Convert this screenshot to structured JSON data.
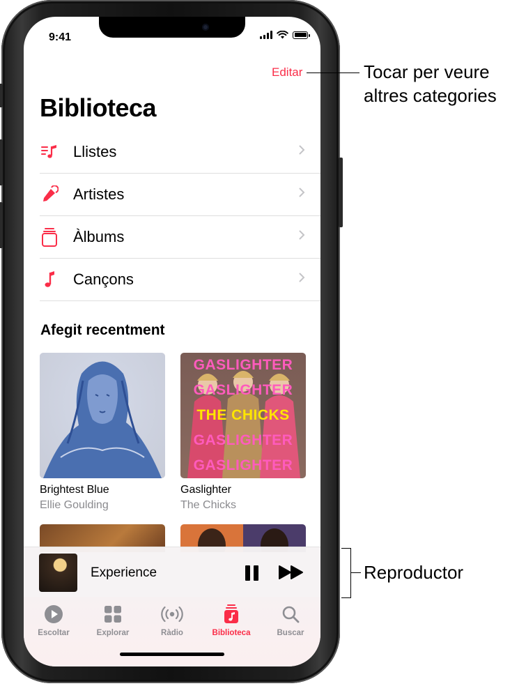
{
  "status_bar": {
    "time": "9:41"
  },
  "header": {
    "edit_label": "Editar",
    "title": "Biblioteca"
  },
  "library_menu": [
    {
      "label": "Llistes",
      "icon": "playlist-icon"
    },
    {
      "label": "Artistes",
      "icon": "microphone-icon"
    },
    {
      "label": "Àlbums",
      "icon": "album-stack-icon"
    },
    {
      "label": "Cançons",
      "icon": "music-note-icon"
    }
  ],
  "recently_added": {
    "title": "Afegit recentment",
    "albums": [
      {
        "title": "Brightest Blue",
        "artist": "Ellie Goulding"
      },
      {
        "title": "Gaslighter",
        "artist": "The Chicks"
      }
    ],
    "gaslighter_cover_text": [
      "GASLIGHTER",
      "GASLIGHTER",
      "THE CHICKS",
      "GASLIGHTER",
      "GASLIGHTER"
    ]
  },
  "mini_player": {
    "title": "Experience"
  },
  "tab_bar": [
    {
      "label": "Escoltar",
      "icon": "play-circle-icon"
    },
    {
      "label": "Explorar",
      "icon": "grid-icon"
    },
    {
      "label": "Ràdio",
      "icon": "radio-waves-icon"
    },
    {
      "label": "Biblioteca",
      "icon": "library-icon",
      "active": true
    },
    {
      "label": "Buscar",
      "icon": "search-icon"
    }
  ],
  "annotations": {
    "edit_callout": [
      "Tocar per veure",
      "altres categories"
    ],
    "player_callout": "Reproductor"
  },
  "colors": {
    "accent": "#fa2d48",
    "secondary_text": "#8a8a8e"
  }
}
